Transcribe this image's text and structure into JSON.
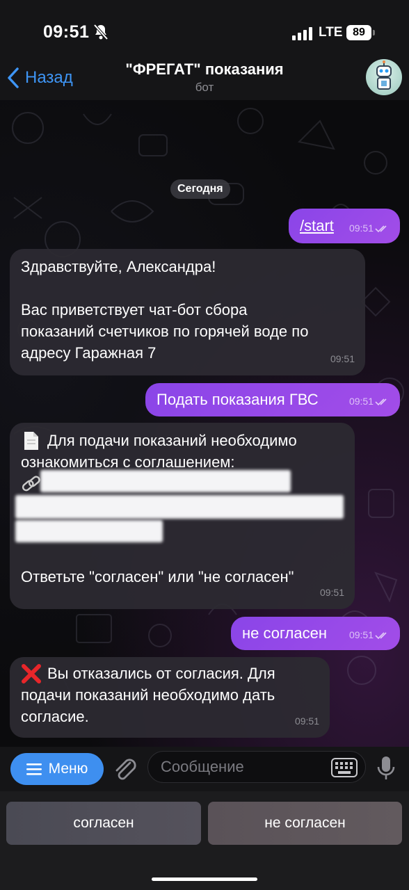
{
  "status_bar": {
    "time": "09:51",
    "network": "LTE",
    "battery": "89"
  },
  "header": {
    "back_label": "Назад",
    "title": "\"ФРЕГАТ\" показания",
    "subtitle": "бот"
  },
  "chat": {
    "date_label": "Сегодня",
    "messages": [
      {
        "direction": "out",
        "text": "/start",
        "time": "09:51"
      },
      {
        "direction": "in",
        "text": "Здравствуйте, Александра!\n\nВас приветствует чат-бот сбора\nпоказаний счетчиков по горячей воде по\nадресу Гаражная 7",
        "time": "09:51"
      },
      {
        "direction": "out",
        "text": "Подать показания ГВС",
        "time": "09:51"
      },
      {
        "direction": "in",
        "text": "Для подачи показаний необходимо\nознакомиться с соглашением:",
        "text2": "Ответьте \"согласен\" или \"не согласен\"",
        "time": "09:51"
      },
      {
        "direction": "out",
        "text": "не согласен",
        "time": "09:51"
      },
      {
        "direction": "in",
        "text": "Вы отказались от согласия. Для\nподачи показаний необходимо дать\nсогласие.",
        "time": "09:51"
      }
    ]
  },
  "input_bar": {
    "menu_label": "Меню",
    "placeholder": "Сообщение"
  },
  "reply_keyboard": {
    "buttons": [
      "согласен",
      "не согласен"
    ]
  },
  "colors": {
    "accent": "#3e8ff0",
    "outgoing": "#9a4ae8",
    "incoming": "#2c2a32"
  }
}
